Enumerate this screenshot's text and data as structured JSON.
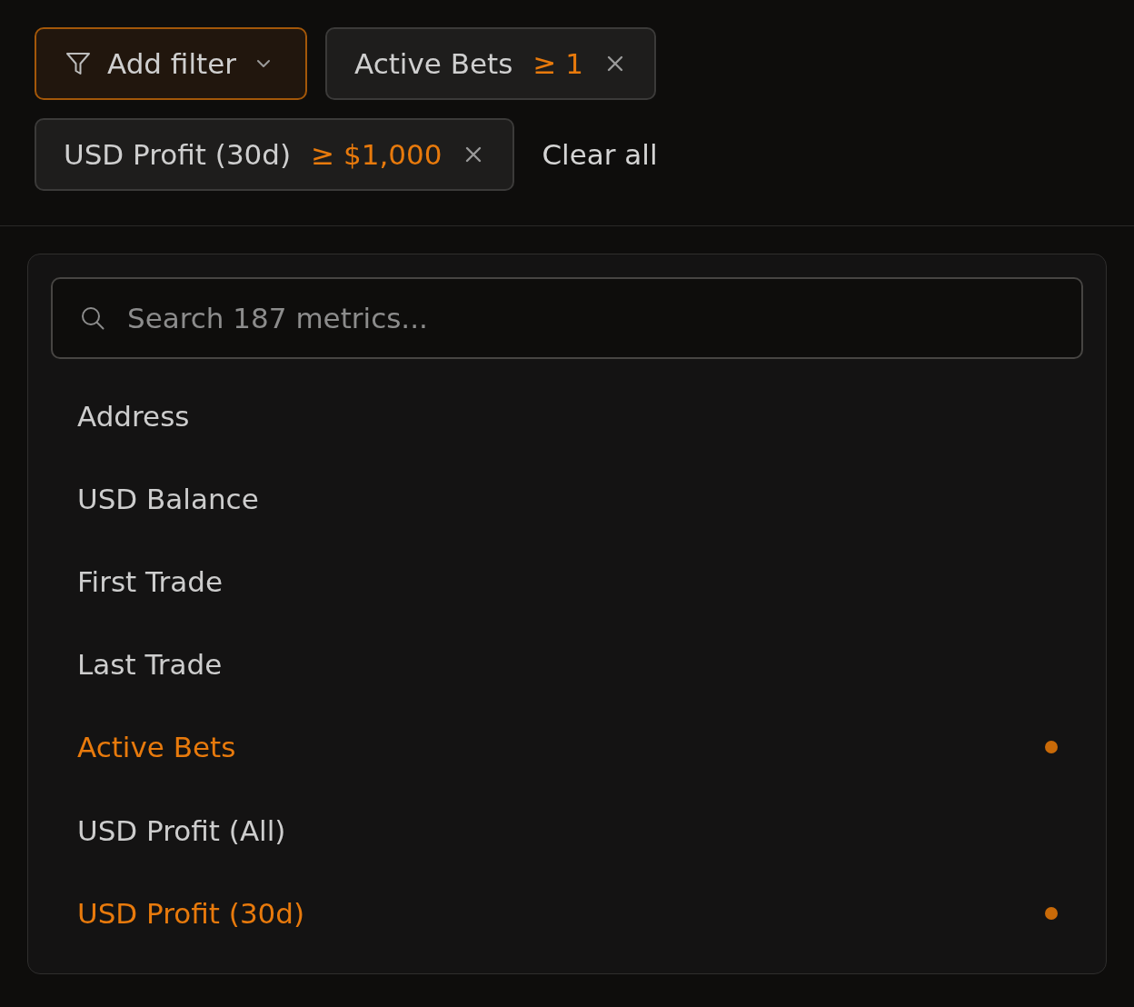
{
  "filter_bar": {
    "add_filter": {
      "label": "Add filter",
      "expanded": true
    },
    "filters": [
      {
        "label": "Active Bets",
        "condition": "≥ 1"
      },
      {
        "label": "USD Profit (30d)",
        "condition": "≥ $1,000"
      }
    ],
    "clear_all": "Clear all"
  },
  "metric_menu": {
    "search": {
      "placeholder": "Search 187 metrics..."
    },
    "items": [
      {
        "label": "Address",
        "selected": false
      },
      {
        "label": "USD Balance",
        "selected": false
      },
      {
        "label": "First Trade",
        "selected": false
      },
      {
        "label": "Last Trade",
        "selected": false
      },
      {
        "label": "Active Bets",
        "selected": true
      },
      {
        "label": "USD Profit (All)",
        "selected": false
      },
      {
        "label": "USD Profit (30d)",
        "selected": true
      }
    ]
  }
}
